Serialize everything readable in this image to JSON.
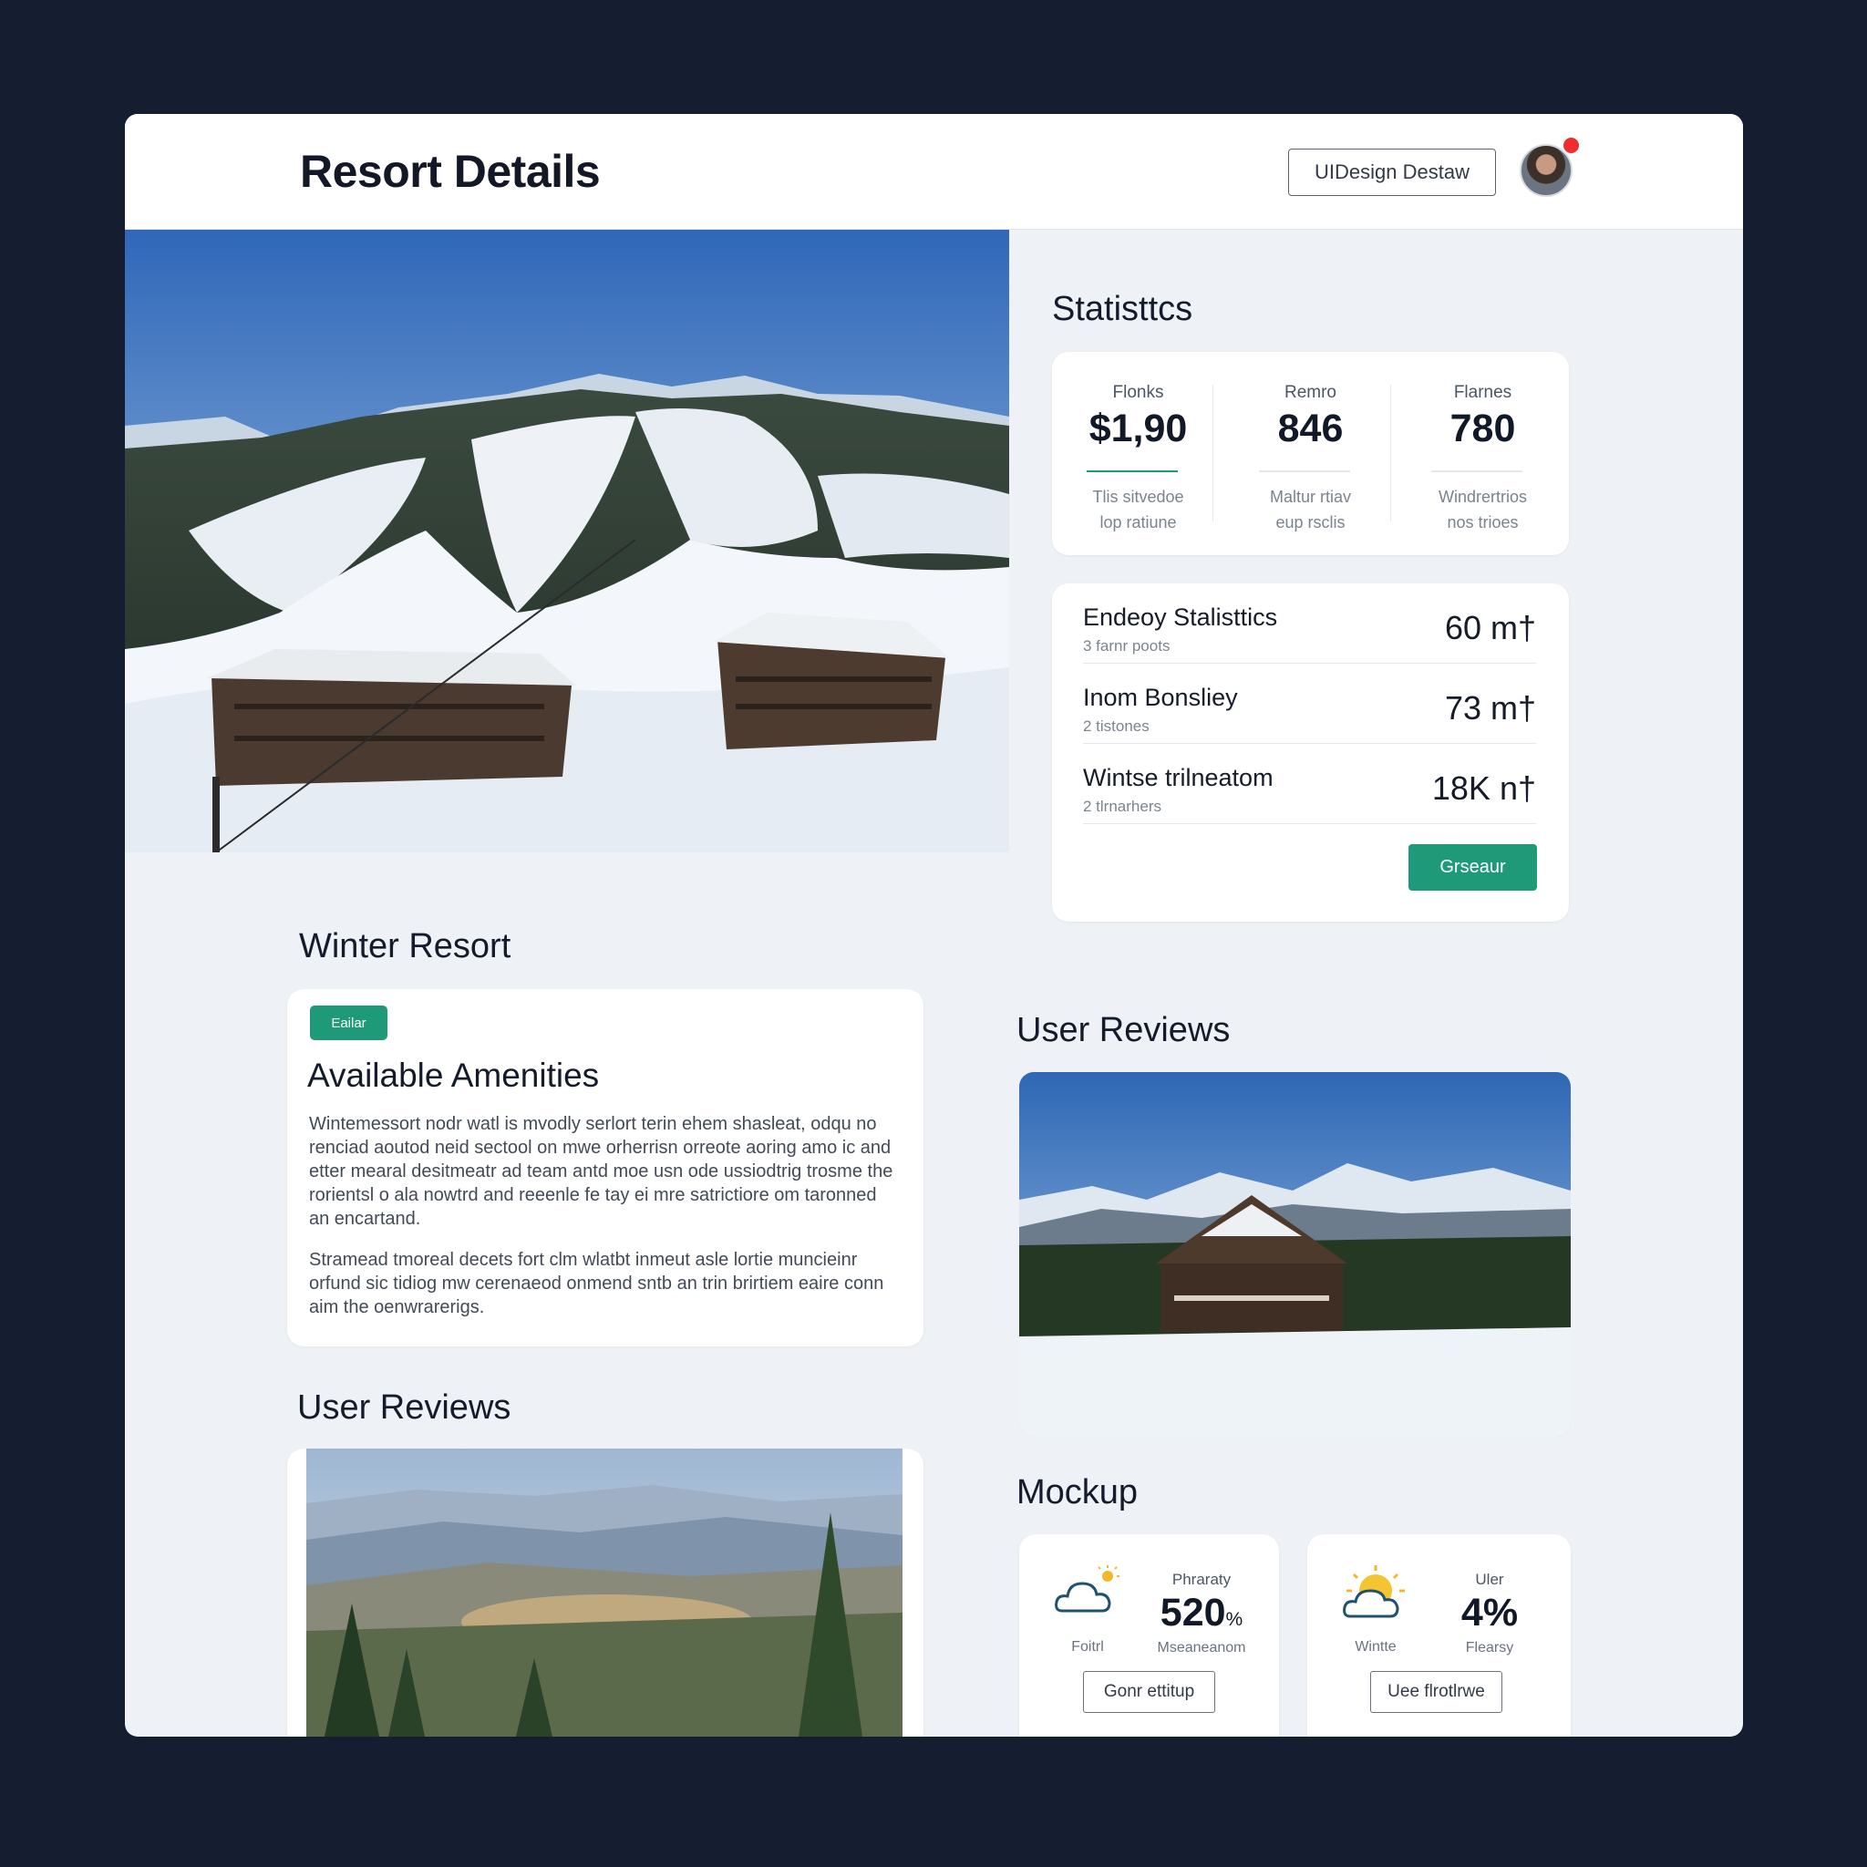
{
  "header": {
    "title": "Resort Details",
    "workspace_button": "UIDesign Destaw"
  },
  "statistics": {
    "title": "Statisttcs",
    "columns": [
      {
        "label": "Flonks",
        "value": "$1,90",
        "desc_line1": "Tlis sitvedoe",
        "desc_line2": "lop ratiune"
      },
      {
        "label": "Remro",
        "value": "846",
        "desc_line1": "Maltur rtiav",
        "desc_line2": "eup rsclis"
      },
      {
        "label": "Flarnes",
        "value": "780",
        "desc_line1": "Windrertrios",
        "desc_line2": "nos trioes"
      }
    ]
  },
  "energy": {
    "rows": [
      {
        "name": "Endeoy Stalisttics",
        "sub": "3 farnr poots",
        "value": "60 m†"
      },
      {
        "name": "Inom Bonsliey",
        "sub": "2 tistones",
        "value": "73 m†"
      },
      {
        "name": "Wintse trilneatom",
        "sub": "2 tlrnarhers",
        "value": "18K n†"
      }
    ],
    "button": "Grseaur"
  },
  "winter": {
    "section_title": "Winter Resort",
    "tag": "Eailar",
    "card_title": "Available Amenities",
    "p1": "Wintemessort nodr watl is mvodly serlort terin ehem shasleat, odqu no renciad aoutod neid sectool on mwe orherrisn orreote aoring amo ic and etter mearal desitmeatr ad team antd moe usn ode ussiodtrig trosme the rorientsl o ala nowtrd and reeenle fe tay ei mre satrictiore om taronned an encartand.",
    "p2": "Stramead tmoreal decets fort clm wlatbt inmeut asle lortie muncieinr orfund sic tidiog mw cerenaeod onmend sntb an trin brirtiem eaire conn aim the oenwrarerigs."
  },
  "reviews_left": {
    "title": "User Reviews"
  },
  "reviews_right": {
    "title": "User Reviews"
  },
  "mockup": {
    "title": "Mockup",
    "cards": [
      {
        "icon": "cloud-sun-icon",
        "icon_label": "Foitrl",
        "head": "Phraraty",
        "value": "520",
        "unit": "%",
        "sub": "Mseaneanom",
        "button": "Gonr ettitup"
      },
      {
        "icon": "sun-cloud-icon",
        "icon_label": "Wintte",
        "head": "Uler",
        "value": "4%",
        "unit": "",
        "sub": "Flearsy",
        "button": "Uee flrotlrwe"
      }
    ]
  },
  "colors": {
    "accent": "#1f9a78",
    "background": "#151d30",
    "panel": "#eef1f5",
    "notification": "#ef2d2d"
  }
}
